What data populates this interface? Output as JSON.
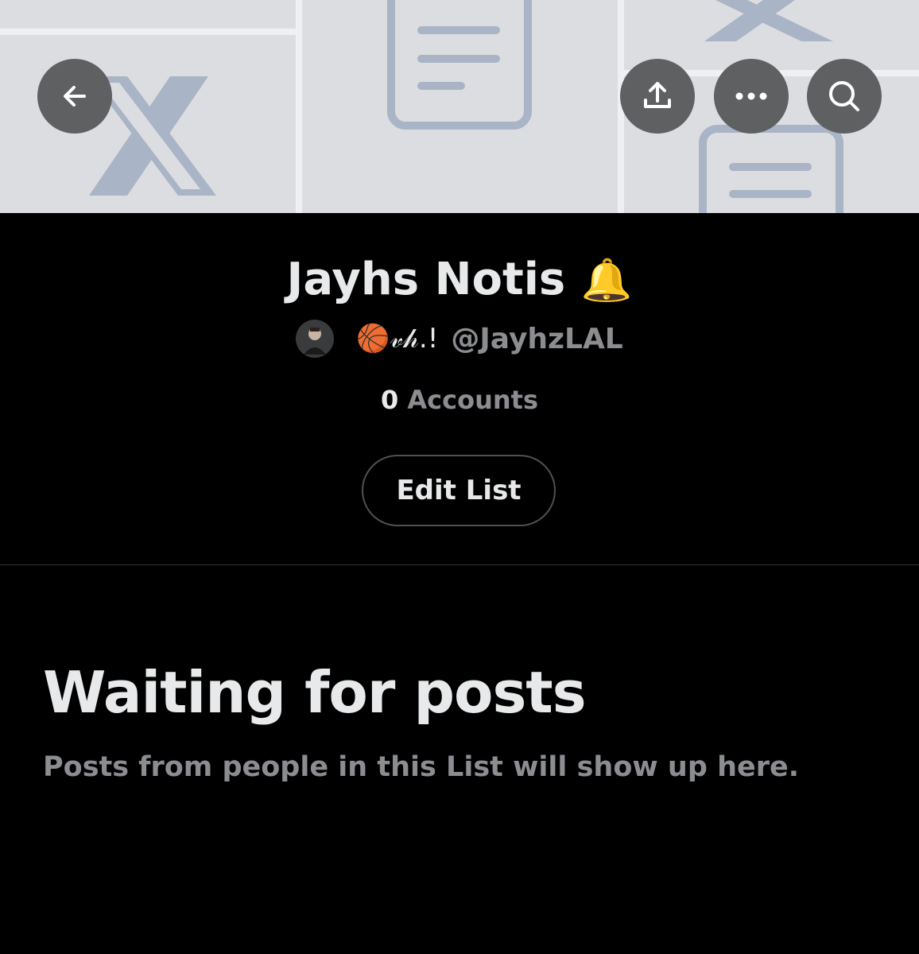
{
  "banner": {
    "background": "#dcdde0",
    "pattern_color": "#a9b4c6",
    "nav": {
      "back_icon": "arrow-left-icon",
      "share_icon": "share-icon",
      "more_icon": "more-horizontal-icon",
      "search_icon": "search-icon"
    }
  },
  "list": {
    "title": "Jayhs Notis",
    "title_emoji": "🔔",
    "owner": {
      "name": "🏀𝓋𝒽.!",
      "handle": "@JayhzLAL"
    },
    "accounts_count": "0",
    "accounts_label": "Accounts",
    "edit_button": "Edit List"
  },
  "empty_state": {
    "title": "Waiting for posts",
    "subtitle": "Posts from people in this List will show up here."
  },
  "colors": {
    "background": "#000000",
    "primary_text": "#e7e9ea",
    "secondary_text": "#8b8d91",
    "border": "#4d5055",
    "nav_button": "#5f6062"
  }
}
